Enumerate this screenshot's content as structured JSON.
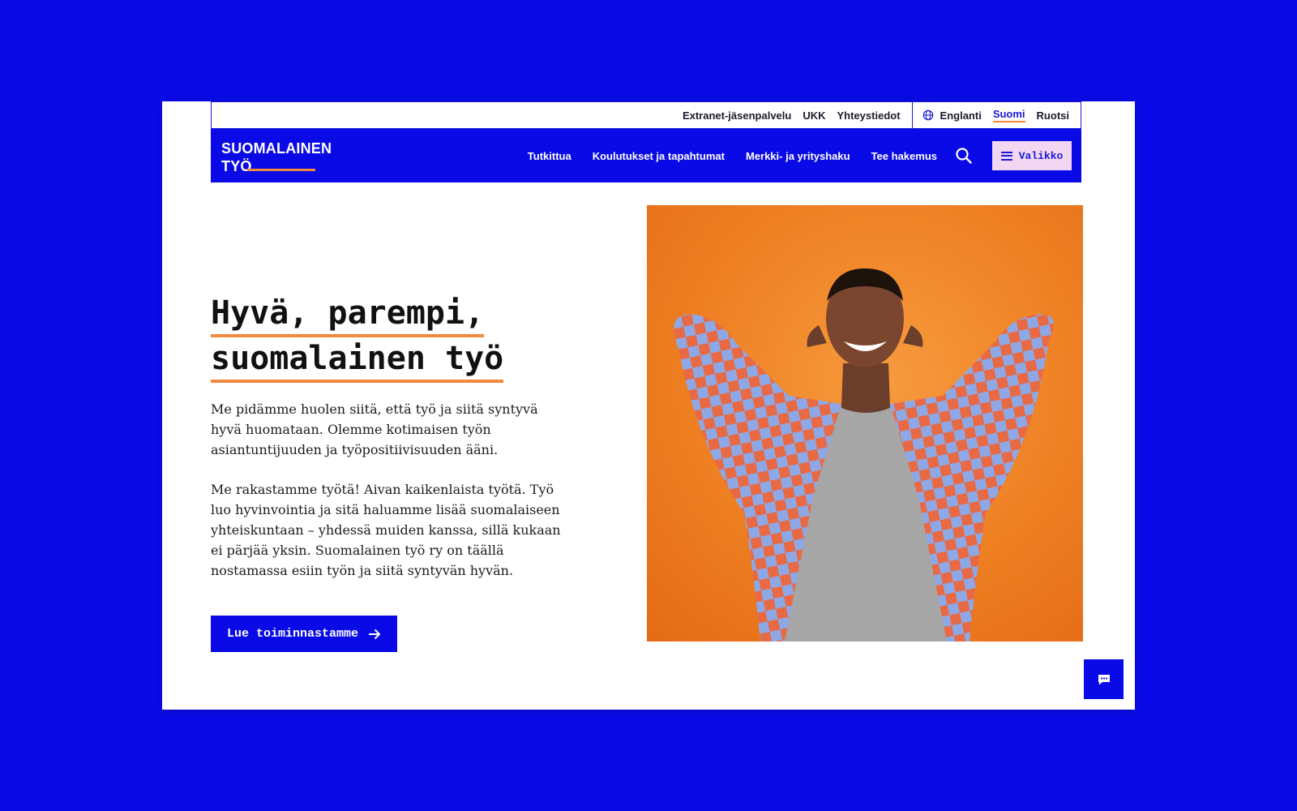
{
  "topbar": {
    "links": [
      "Extranet-jäsenpalvelu",
      "UKK",
      "Yhteystiedot"
    ],
    "languages": [
      {
        "label": "Englanti",
        "active": false
      },
      {
        "label": "Suomi",
        "active": true
      },
      {
        "label": "Ruotsi",
        "active": false
      }
    ],
    "language_icon": "globe-icon"
  },
  "logo": {
    "line1": "SUOMALAINEN",
    "line2": "TYÖ"
  },
  "nav": {
    "links": [
      "Tutkittua",
      "Koulutukset ja tapahtumat",
      "Merkki- ja yrityshaku",
      "Tee hakemus"
    ],
    "search_icon": "search-icon",
    "menu_label": "Valikko",
    "menu_icon": "hamburger-icon"
  },
  "hero": {
    "title_line1": "Hyvä, parempi,",
    "title_line2": "suomalainen työ",
    "paragraph1": "Me pidämme huolen siitä, että työ ja siitä syntyvä hyvä huomataan. Olemme kotimaisen työn asiantuntijuuden ja työpositiivisuuden ääni.",
    "paragraph2": "Me rakastamme työtä! Aivan kaikenlaista työtä. Työ luo hyvinvointia ja sitä haluamme lisää suomalaiseen yhteiskuntaan – yhdessä muiden kanssa, sillä kukaan ei pärjää yksin. Suomalainen työ ry on täällä nostamassa esiin työn ja siitä syntyvän hyvän.",
    "cta_label": "Lue toiminnastamme",
    "cta_icon": "arrow-right-icon"
  },
  "chat": {
    "icon": "chat-icon"
  },
  "colors": {
    "brand_blue": "#0a0ae6",
    "accent_orange": "#f08a3c",
    "menu_pink": "#f2d6f2"
  }
}
